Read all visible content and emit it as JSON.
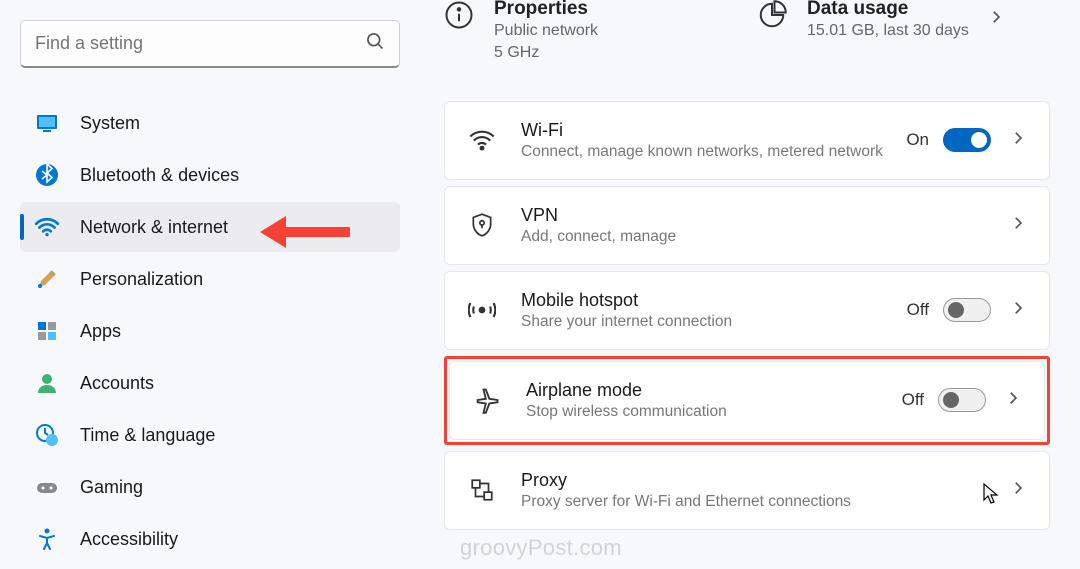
{
  "search": {
    "placeholder": "Find a setting"
  },
  "sidebar": {
    "items": [
      {
        "label": "System"
      },
      {
        "label": "Bluetooth & devices"
      },
      {
        "label": "Network & internet"
      },
      {
        "label": "Personalization"
      },
      {
        "label": "Apps"
      },
      {
        "label": "Accounts"
      },
      {
        "label": "Time & language"
      },
      {
        "label": "Gaming"
      },
      {
        "label": "Accessibility"
      }
    ]
  },
  "top": {
    "properties": {
      "title": "Properties",
      "sub1": "Public network",
      "sub2": "5 GHz"
    },
    "data_usage": {
      "title": "Data usage",
      "sub": "15.01 GB, last 30 days"
    }
  },
  "cards": {
    "wifi": {
      "title": "Wi-Fi",
      "sub": "Connect, manage known networks, metered network",
      "state": "On"
    },
    "vpn": {
      "title": "VPN",
      "sub": "Add, connect, manage"
    },
    "hotspot": {
      "title": "Mobile hotspot",
      "sub": "Share your internet connection",
      "state": "Off"
    },
    "airplane": {
      "title": "Airplane mode",
      "sub": "Stop wireless communication",
      "state": "Off"
    },
    "proxy": {
      "title": "Proxy",
      "sub": "Proxy server for Wi-Fi and Ethernet connections"
    }
  },
  "watermark": "groovyPost.com"
}
